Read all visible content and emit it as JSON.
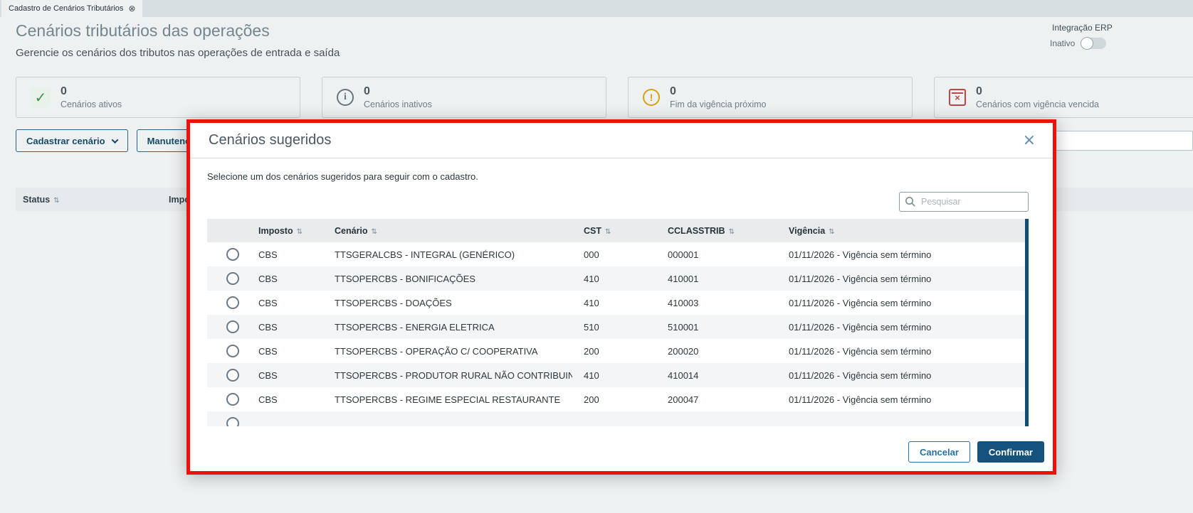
{
  "browser_tab": {
    "title": "Cadastro de Cenários Tributários"
  },
  "page": {
    "title": "Cenários tributários das operações",
    "subtitle": "Gerencie os cenários dos tributos nas operações de entrada e saída",
    "erp_integration": {
      "label": "Integração ERP",
      "status": "Inativo"
    },
    "cards": [
      {
        "count": "0",
        "label": "Cenários ativos"
      },
      {
        "count": "0",
        "label": "Cenários inativos"
      },
      {
        "count": "0",
        "label": "Fim da vigência próximo"
      },
      {
        "count": "0",
        "label": "Cenários com vigência vencida"
      }
    ],
    "toolbar": {
      "register_label": "Cadastrar cenário",
      "maintenance_label": "Manutenção em"
    },
    "table": {
      "status_col": "Status",
      "imposto_col": "Imposto"
    }
  },
  "modal": {
    "title": "Cenários sugeridos",
    "description": "Selecione um dos cenários sugeridos para seguir com o cadastro.",
    "search_placeholder": "Pesquisar",
    "columns": {
      "imposto": "Imposto",
      "cenario": "Cenário",
      "cst": "CST",
      "cclasstrib": "CCLASSTRIB",
      "vigencia": "Vigência"
    },
    "rows": [
      {
        "imposto": "CBS",
        "cenario": "TTSGERALCBS - INTEGRAL (GENÉRICO)",
        "cst": "000",
        "cclasstrib": "000001",
        "vigencia": "01/11/2026 - Vigência sem término"
      },
      {
        "imposto": "CBS",
        "cenario": "TTSOPERCBS - BONIFICAÇÕES",
        "cst": "410",
        "cclasstrib": "410001",
        "vigencia": "01/11/2026 - Vigência sem término"
      },
      {
        "imposto": "CBS",
        "cenario": "TTSOPERCBS - DOAÇÕES",
        "cst": "410",
        "cclasstrib": "410003",
        "vigencia": "01/11/2026 - Vigência sem término"
      },
      {
        "imposto": "CBS",
        "cenario": "TTSOPERCBS - ENERGIA ELETRICA",
        "cst": "510",
        "cclasstrib": "510001",
        "vigencia": "01/11/2026 - Vigência sem término"
      },
      {
        "imposto": "CBS",
        "cenario": "TTSOPERCBS - OPERAÇÃO C/ COOPERATIVA",
        "cst": "200",
        "cclasstrib": "200020",
        "vigencia": "01/11/2026 - Vigência sem término"
      },
      {
        "imposto": "CBS",
        "cenario": "TTSOPERCBS - PRODUTOR RURAL NÃO CONTRIBUINTE",
        "cst": "410",
        "cclasstrib": "410014",
        "vigencia": "01/11/2026 - Vigência sem término"
      },
      {
        "imposto": "CBS",
        "cenario": "TTSOPERCBS - REGIME ESPECIAL RESTAURANTE",
        "cst": "200",
        "cclasstrib": "200047",
        "vigencia": "01/11/2026 - Vigência sem término"
      }
    ],
    "has_partial_row": true,
    "footer": {
      "cancel_label": "Cancelar",
      "confirm_label": "Confirmar"
    }
  },
  "icons": {
    "sort": "⇅",
    "modal_close": "×",
    "tab_close": "⊗",
    "check": "✓",
    "info": "i",
    "warning": "!",
    "calendar_x": "×"
  },
  "colors": {
    "accent": "#15527d",
    "annotation_border": "#ea120b",
    "success": "#3f8f4f",
    "warning": "#d9a012",
    "danger": "#c14545",
    "scrollbar": "#0f4f73"
  }
}
